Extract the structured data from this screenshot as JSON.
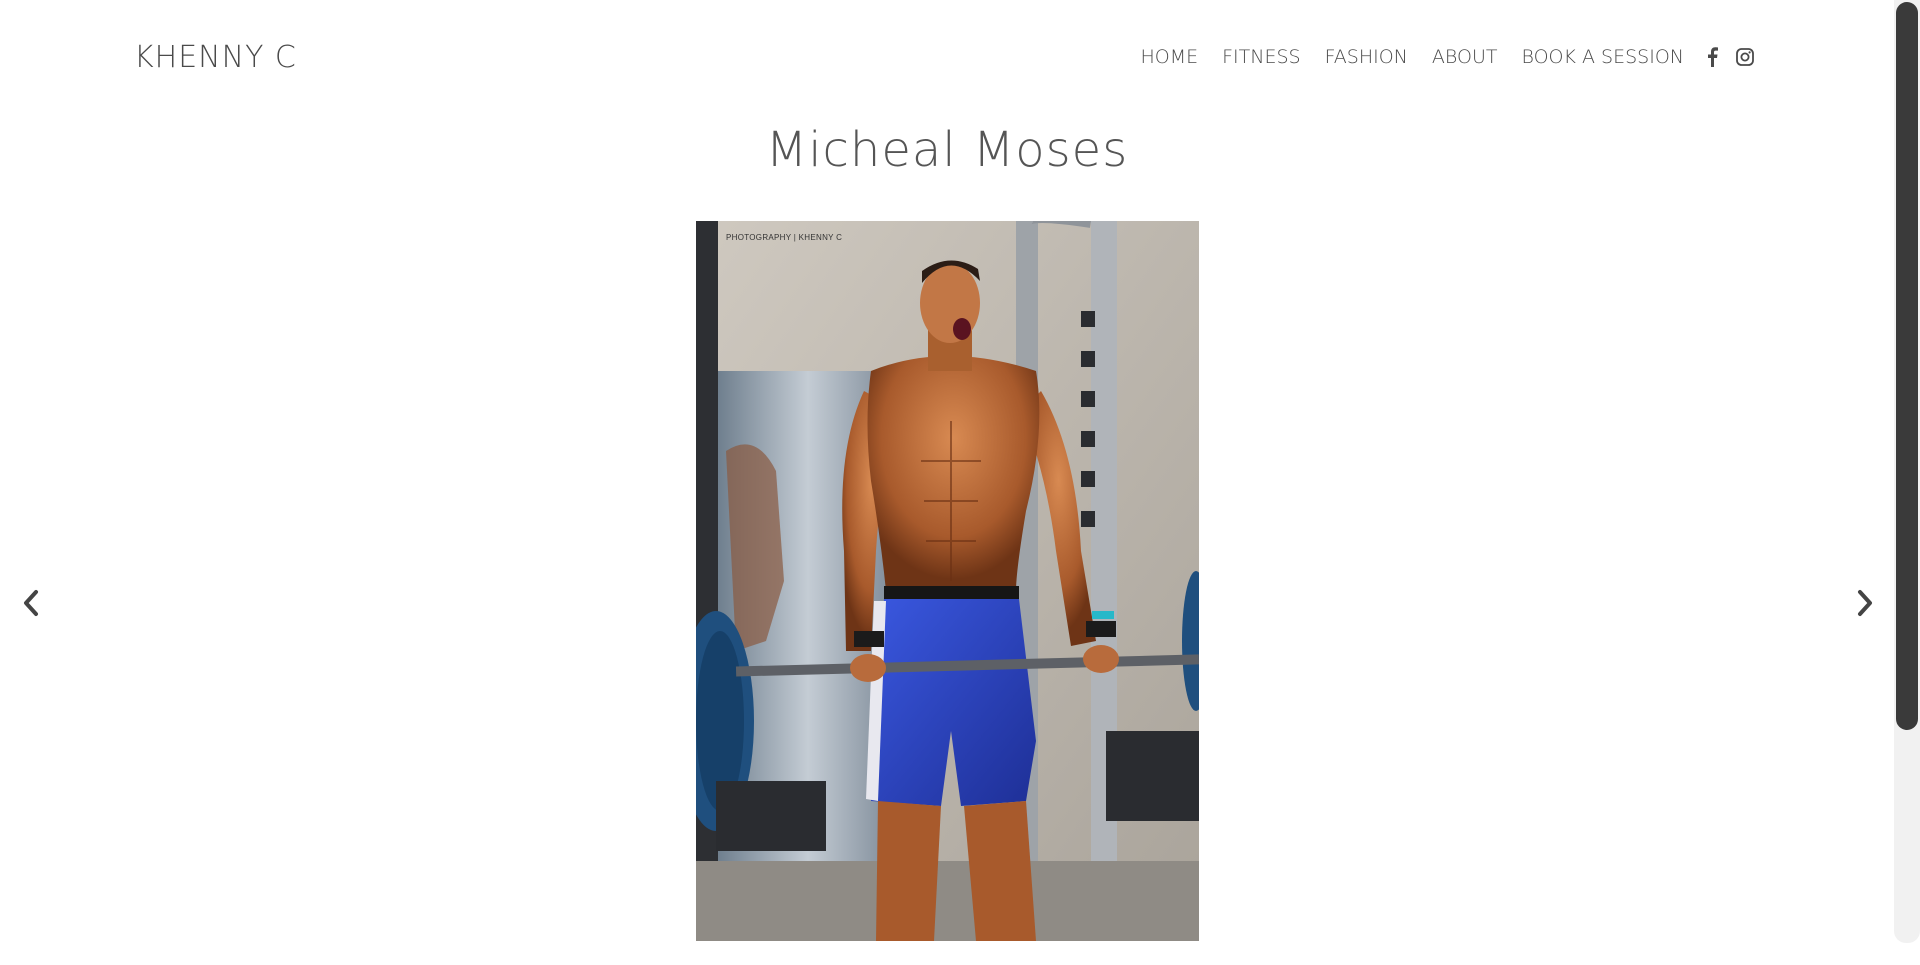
{
  "header": {
    "logo": "KHENNY C",
    "nav": [
      {
        "label": "HOME"
      },
      {
        "label": "FITNESS"
      },
      {
        "label": "FASHION"
      },
      {
        "label": "ABOUT"
      },
      {
        "label": "BOOK A SESSION"
      }
    ],
    "social": [
      "facebook-icon",
      "instagram-icon"
    ]
  },
  "gallery": {
    "title": "Micheal Moses",
    "watermark": "PHOTOGRAPHY | KHENNY C",
    "prev_icon": "chevron-left-icon",
    "next_icon": "chevron-right-icon"
  },
  "colors": {
    "text": "#4a4a4a",
    "shorts": "#2f49c9",
    "skin": "#b86b3c",
    "scrollbar_thumb": "#3a3a3a"
  }
}
